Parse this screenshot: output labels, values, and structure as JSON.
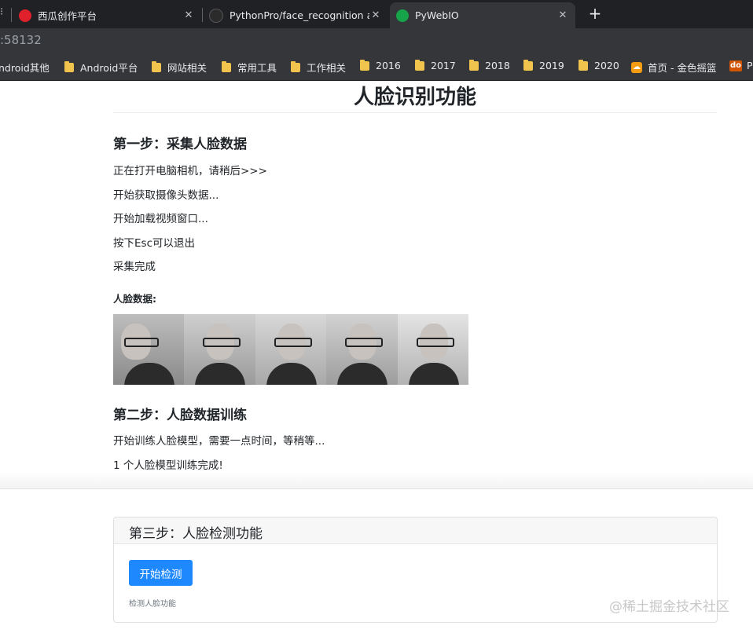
{
  "browser": {
    "tabs": [
      {
        "title": "西瓜创作平台",
        "active": false,
        "favicon_color": "#e0202a"
      },
      {
        "title": "PythonPro/face_recognition at",
        "active": false,
        "favicon_color": "#2b2b2b"
      },
      {
        "title": "PyWebIO",
        "active": true,
        "favicon_color": "#16a34a"
      }
    ],
    "tab_close_glyph": "✕",
    "new_tab_glyph": "+",
    "address_text": ":58132",
    "bookmarks": [
      {
        "label": "ndroid其他",
        "icon": "folder-icon"
      },
      {
        "label": "Android平台",
        "icon": "folder-icon"
      },
      {
        "label": "网站相关",
        "icon": "folder-icon"
      },
      {
        "label": "常用工具",
        "icon": "folder-icon"
      },
      {
        "label": "工作相关",
        "icon": "folder-icon"
      },
      {
        "label": "2016",
        "icon": "folder-icon"
      },
      {
        "label": "2017",
        "icon": "folder-icon"
      },
      {
        "label": "2018",
        "icon": "folder-icon"
      },
      {
        "label": "2019",
        "icon": "folder-icon"
      },
      {
        "label": "2020",
        "icon": "folder-icon"
      },
      {
        "label": "首页 - 金色摇篮",
        "icon": "site-icon"
      },
      {
        "label": "P",
        "icon": "do-icon"
      }
    ]
  },
  "page": {
    "title": "人脸识别功能",
    "step1": {
      "heading": "第一步：采集人脸数据",
      "lines": [
        "正在打开电脑相机，请稍后>>>",
        "开始获取摄像头数据...",
        "开始加载视频窗口...",
        "按下Esc可以退出",
        "采集完成"
      ],
      "face_data_label": "人脸数据:",
      "face_count": 5
    },
    "step2": {
      "heading": "第二步：人脸数据训练",
      "lines": [
        "开始训练人脸模型，需要一点时间，等稍等...",
        "1 个人脸模型训练完成!"
      ]
    },
    "step3": {
      "heading": "第三步：人脸检测功能",
      "button_label": "开始检测",
      "help_text": "检测人脸功能"
    }
  },
  "watermark": "@稀土掘金技术社区",
  "colors": {
    "primary_button": "#1e88ff",
    "tabbar": "#202124",
    "toolbar": "#35363a"
  }
}
